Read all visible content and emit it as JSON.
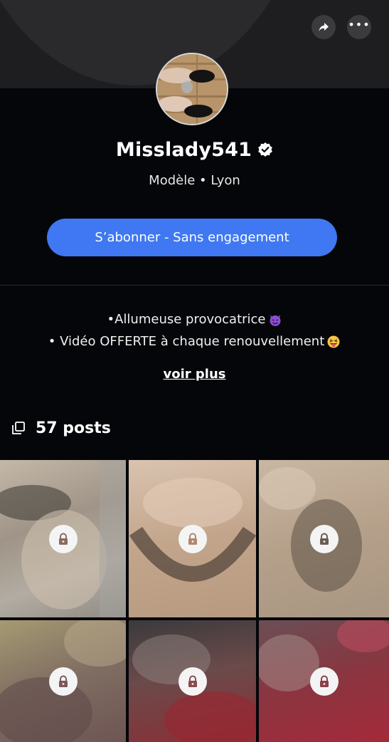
{
  "header": {
    "share_icon": "share-icon",
    "more_icon": "more-dots-icon",
    "more_label": "•••"
  },
  "profile": {
    "username": "Misslady541",
    "verified": true,
    "subtitle": "Modèle • Lyon",
    "subscribe_label": "S’abonner - Sans engagement",
    "accent_color": "#3f78f2"
  },
  "bio": {
    "line1": "•Allumeuse provocatrice",
    "line1_emoji": "devil-emoji",
    "line2": "• Vidéo OFFERTE à chaque renouvellement",
    "line2_emoji": "tongue-wink-emoji",
    "more_label": "voir plus"
  },
  "posts": {
    "count_label": "57 posts",
    "icon": "posts-stack-icon",
    "items": [
      {
        "locked": true
      },
      {
        "locked": true
      },
      {
        "locked": true
      },
      {
        "locked": true
      },
      {
        "locked": true
      },
      {
        "locked": true
      }
    ]
  }
}
